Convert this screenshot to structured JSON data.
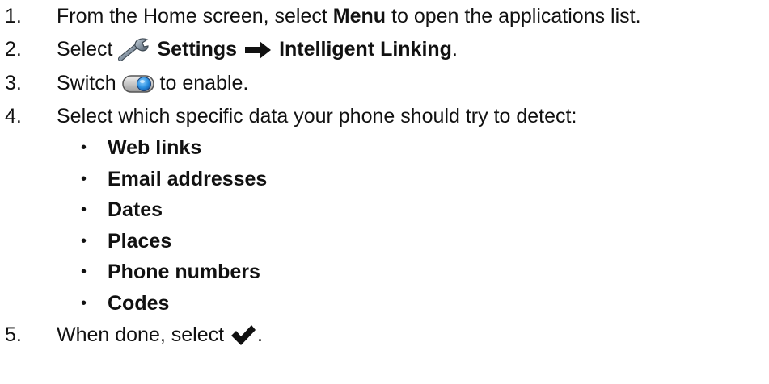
{
  "steps": [
    {
      "number": "1.",
      "text_before": "From the Home screen, select ",
      "bold": "Menu",
      "text_after": " to open the applications list."
    },
    {
      "number": "2.",
      "text_before": "Select ",
      "bold1": "Settings",
      "bold2": "Intelligent Linking",
      "text_after": "."
    },
    {
      "number": "3.",
      "text_before": "Switch ",
      "text_after": " to enable."
    },
    {
      "number": "4.",
      "text": "Select which specific data your phone should try to detect:"
    },
    {
      "number": "5.",
      "text_before": "When done, select ",
      "text_after": "."
    }
  ],
  "bullet_char": "•",
  "data_types": [
    "Web links",
    "Email addresses",
    "Dates",
    "Places",
    "Phone numbers",
    "Codes"
  ],
  "icons": {
    "settings": "wrench-icon",
    "arrow": "right-arrow-icon",
    "toggle": "toggle-switch-icon",
    "done": "checkmark-icon"
  }
}
